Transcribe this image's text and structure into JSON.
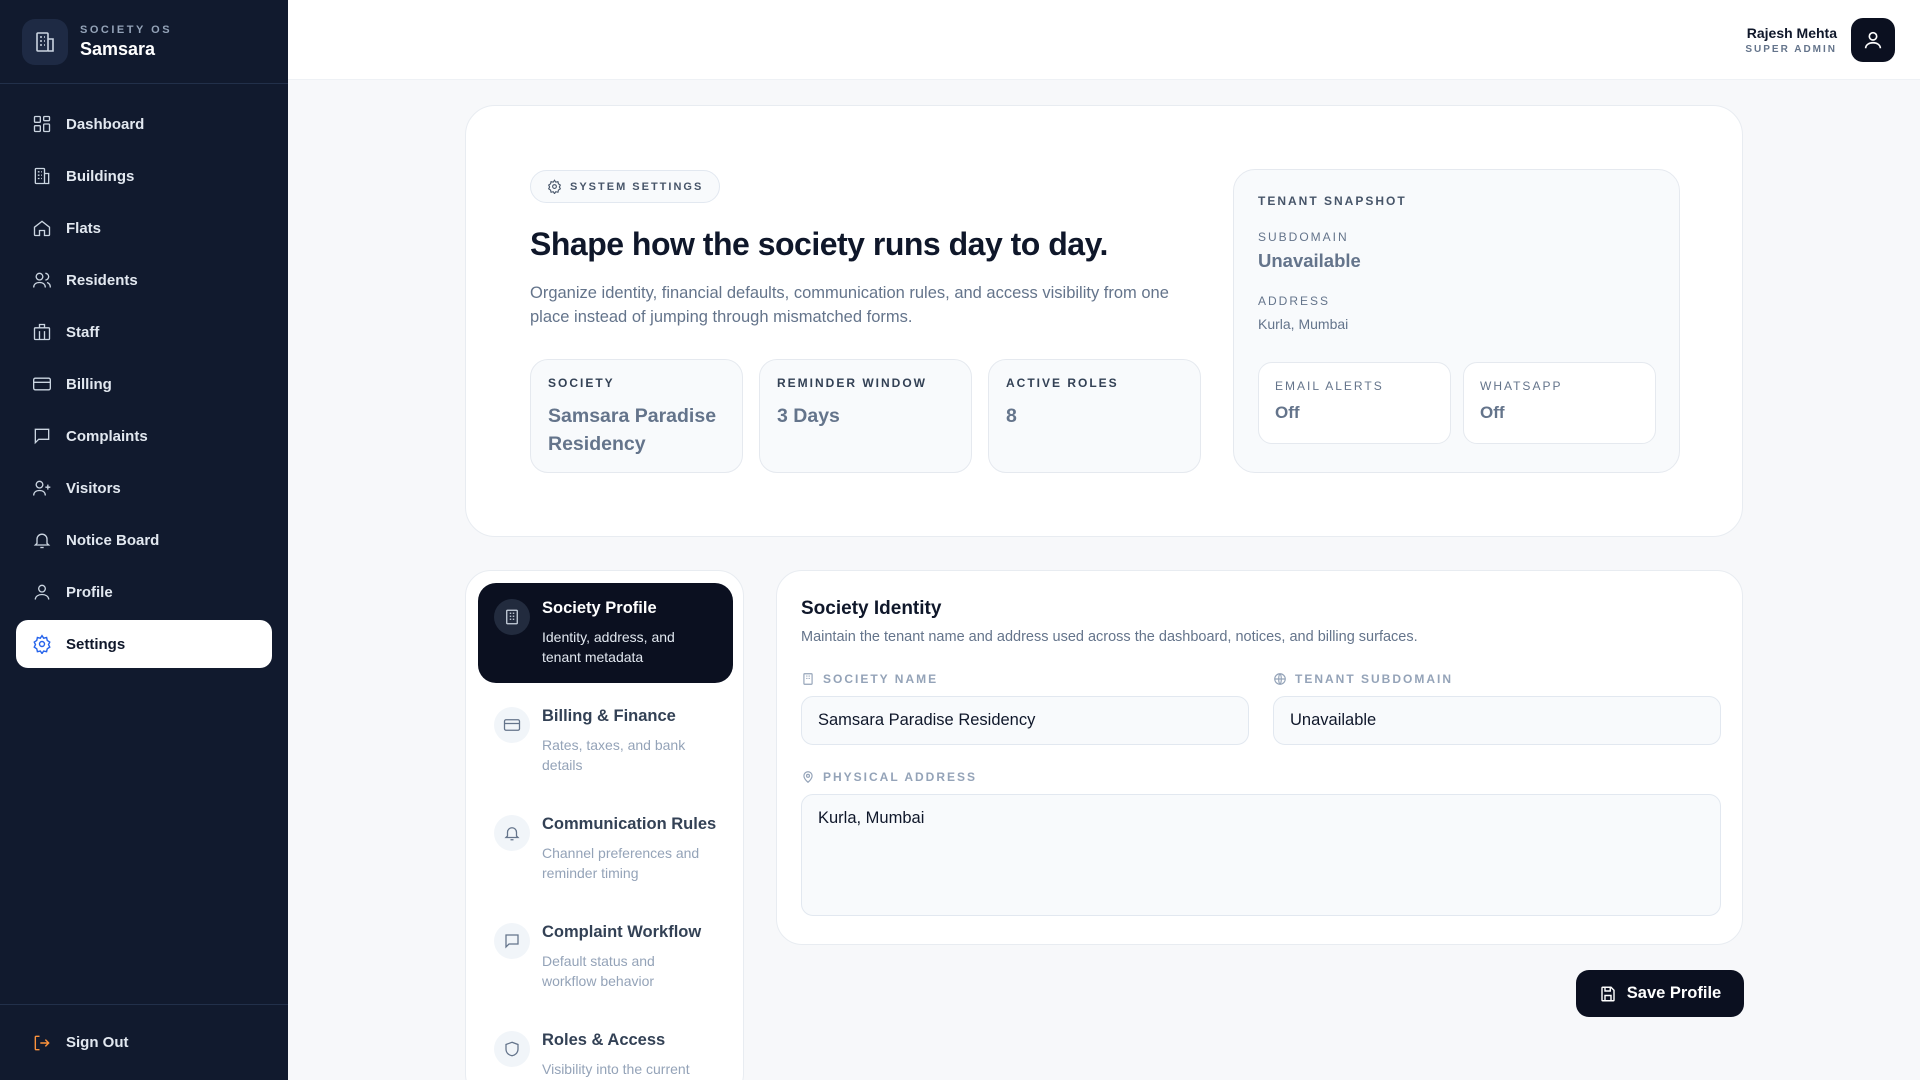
{
  "brand": {
    "eyebrow": "SOCIETY OS",
    "name": "Samsara",
    "logo_icon": "building-icon"
  },
  "sidebar": {
    "items": [
      {
        "label": "Dashboard",
        "icon": "dashboard-icon"
      },
      {
        "label": "Buildings",
        "icon": "buildings-icon"
      },
      {
        "label": "Flats",
        "icon": "home-icon"
      },
      {
        "label": "Residents",
        "icon": "users-icon"
      },
      {
        "label": "Staff",
        "icon": "staff-icon"
      },
      {
        "label": "Billing",
        "icon": "credit-card-icon"
      },
      {
        "label": "Complaints",
        "icon": "chat-icon"
      },
      {
        "label": "Visitors",
        "icon": "user-plus-icon"
      },
      {
        "label": "Notice Board",
        "icon": "bell-icon"
      },
      {
        "label": "Profile",
        "icon": "user-icon"
      },
      {
        "label": "Settings",
        "icon": "gear-icon",
        "active": true
      }
    ],
    "sign_out": "Sign Out"
  },
  "user": {
    "name": "Rajesh Mehta",
    "role": "SUPER ADMIN"
  },
  "hero": {
    "pill": "SYSTEM SETTINGS",
    "title": "Shape how the society runs day to day.",
    "description": "Organize identity, financial defaults, communication rules, and access visibility from one place instead of jumping through mismatched forms.",
    "stats": [
      {
        "label": "SOCIETY",
        "value": "Samsara Paradise Residency"
      },
      {
        "label": "REMINDER WINDOW",
        "value": "3 Days"
      },
      {
        "label": "ACTIVE ROLES",
        "value": "8"
      }
    ]
  },
  "snapshot": {
    "title": "TENANT SNAPSHOT",
    "subdomain_label": "SUBDOMAIN",
    "subdomain_value": "Unavailable",
    "address_label": "ADDRESS",
    "address_value": "Kurla, Mumbai",
    "email_label": "EMAIL ALERTS",
    "email_value": "Off",
    "whatsapp_label": "WHATSAPP",
    "whatsapp_value": "Off"
  },
  "settings_nav": [
    {
      "title": "Society Profile",
      "sub": "Identity, address, and tenant metadata",
      "icon": "building-icon",
      "active": true
    },
    {
      "title": "Billing & Finance",
      "sub": "Rates, taxes, and bank details",
      "icon": "credit-card-icon"
    },
    {
      "title": "Communication Rules",
      "sub": "Channel preferences and reminder timing",
      "icon": "bell-icon"
    },
    {
      "title": "Complaint Workflow",
      "sub": "Default status and workflow behavior",
      "icon": "chat-icon"
    },
    {
      "title": "Roles & Access",
      "sub": "Visibility into the current",
      "icon": "shield-icon"
    }
  ],
  "form": {
    "title": "Society Identity",
    "subtitle": "Maintain the tenant name and address used across the dashboard, notices, and billing surfaces.",
    "society_name_label": "SOCIETY NAME",
    "society_name_value": "Samsara Paradise Residency",
    "subdomain_label": "TENANT SUBDOMAIN",
    "subdomain_value": "Unavailable",
    "address_label": "PHYSICAL ADDRESS",
    "address_value": "Kurla, Mumbai"
  },
  "save_button": "Save Profile"
}
